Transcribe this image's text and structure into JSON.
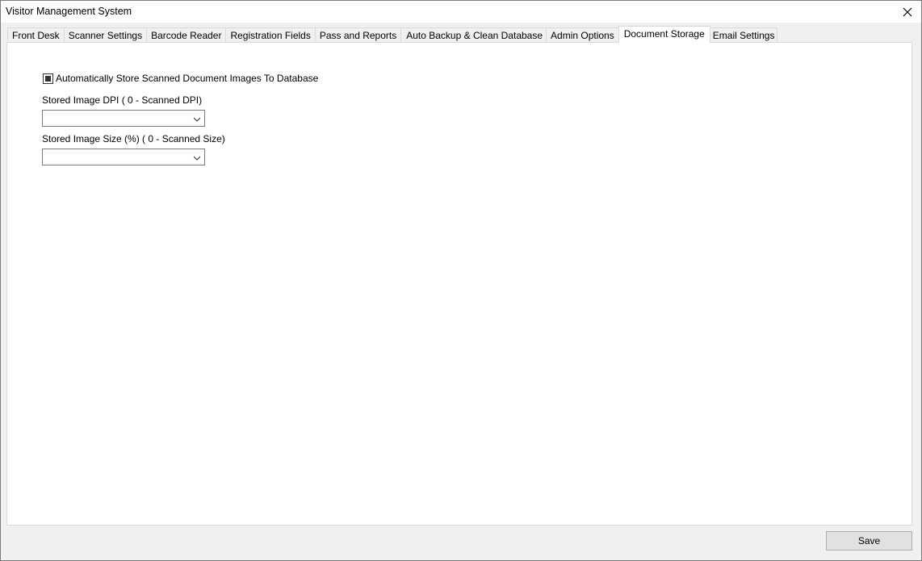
{
  "window": {
    "title": "Visitor Management System",
    "close_icon": "close-icon"
  },
  "tabs": [
    {
      "label": "Front Desk",
      "active": false
    },
    {
      "label": "Scanner Settings",
      "active": false
    },
    {
      "label": "Barcode Reader",
      "active": false
    },
    {
      "label": "Registration Fields",
      "active": false
    },
    {
      "label": "Pass and Reports",
      "active": false
    },
    {
      "label": "Auto Backup & Clean Database",
      "active": false
    },
    {
      "label": "Admin Options",
      "active": false
    },
    {
      "label": "Document Storage",
      "active": true
    },
    {
      "label": "Email Settings",
      "active": false
    }
  ],
  "document_storage": {
    "auto_store": {
      "label": "Automatically Store Scanned Document Images To Database",
      "checked": true
    },
    "dpi": {
      "label": "Stored Image DPI ( 0 - Scanned DPI)",
      "value": ""
    },
    "size": {
      "label": "Stored Image Size (%) ( 0 - Scanned Size)",
      "value": ""
    }
  },
  "footer": {
    "save_label": "Save"
  },
  "colors": {
    "window_bg": "#f0f0f0",
    "panel_bg": "#ffffff",
    "border": "#d9d9d9",
    "button_bg": "#e1e1e1"
  }
}
